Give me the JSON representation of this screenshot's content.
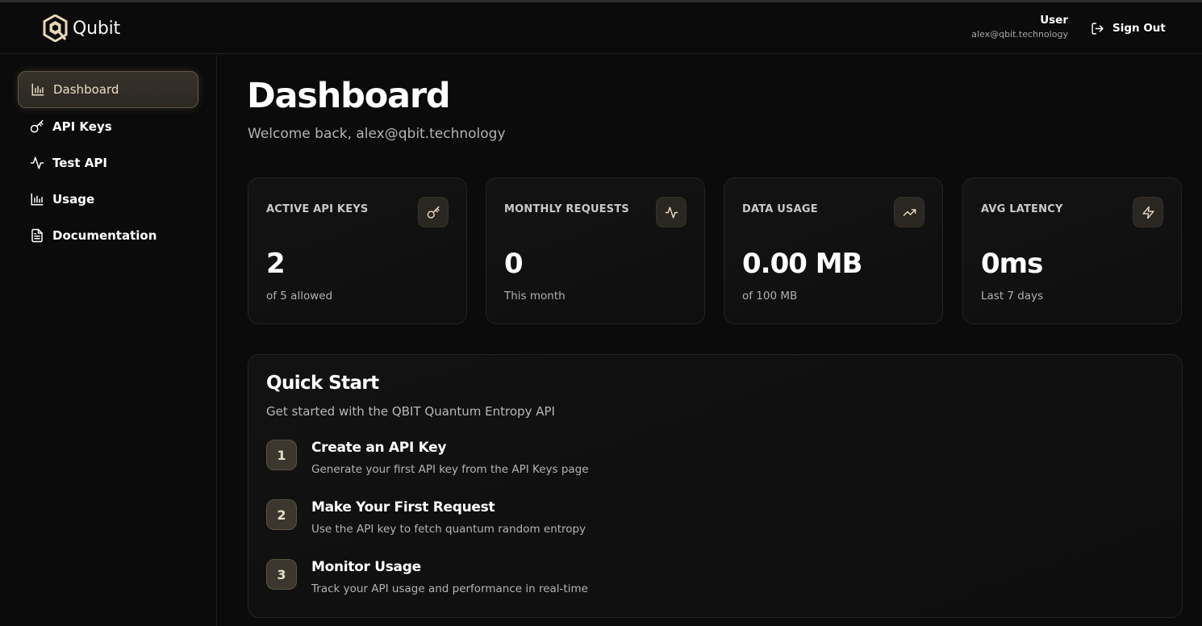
{
  "app": {
    "name": "Qubit"
  },
  "header": {
    "user_label": "User",
    "user_email": "alex@qbit.technology",
    "sign_out_label": "Sign Out"
  },
  "sidebar": {
    "items": [
      {
        "label": "Dashboard",
        "icon": "bar-chart-icon",
        "active": true
      },
      {
        "label": "API Keys",
        "icon": "key-icon",
        "active": false
      },
      {
        "label": "Test API",
        "icon": "activity-icon",
        "active": false
      },
      {
        "label": "Usage",
        "icon": "bar-chart-icon",
        "active": false
      },
      {
        "label": "Documentation",
        "icon": "document-icon",
        "active": false
      }
    ]
  },
  "main": {
    "title": "Dashboard",
    "welcome": "Welcome back, alex@qbit.technology",
    "stats": [
      {
        "title": "ACTIVE API KEYS",
        "value": "2",
        "sub": "of 5 allowed",
        "icon": "key-icon"
      },
      {
        "title": "MONTHLY REQUESTS",
        "value": "0",
        "sub": "This month",
        "icon": "activity-icon"
      },
      {
        "title": "DATA USAGE",
        "value": "0.00 MB",
        "sub": "of 100 MB",
        "icon": "trending-up-icon"
      },
      {
        "title": "AVG LATENCY",
        "value": "0ms",
        "sub": "Last 7 days",
        "icon": "lightning-icon"
      }
    ],
    "quick_start": {
      "title": "Quick Start",
      "subtitle": "Get started with the QBIT Quantum Entropy API",
      "steps": [
        {
          "num": "1",
          "title": "Create an API Key",
          "desc": "Generate your first API key from the API Keys page"
        },
        {
          "num": "2",
          "title": "Make Your First Request",
          "desc": "Use the API key to fetch quantum random entropy"
        },
        {
          "num": "3",
          "title": "Monitor Usage",
          "desc": "Track your API usage and performance in real-time"
        }
      ]
    }
  },
  "colors": {
    "background": "#0b0b0b",
    "accent": "#e9dcc3",
    "card_border": "#232323",
    "active_nav_bg": "#322d27"
  }
}
